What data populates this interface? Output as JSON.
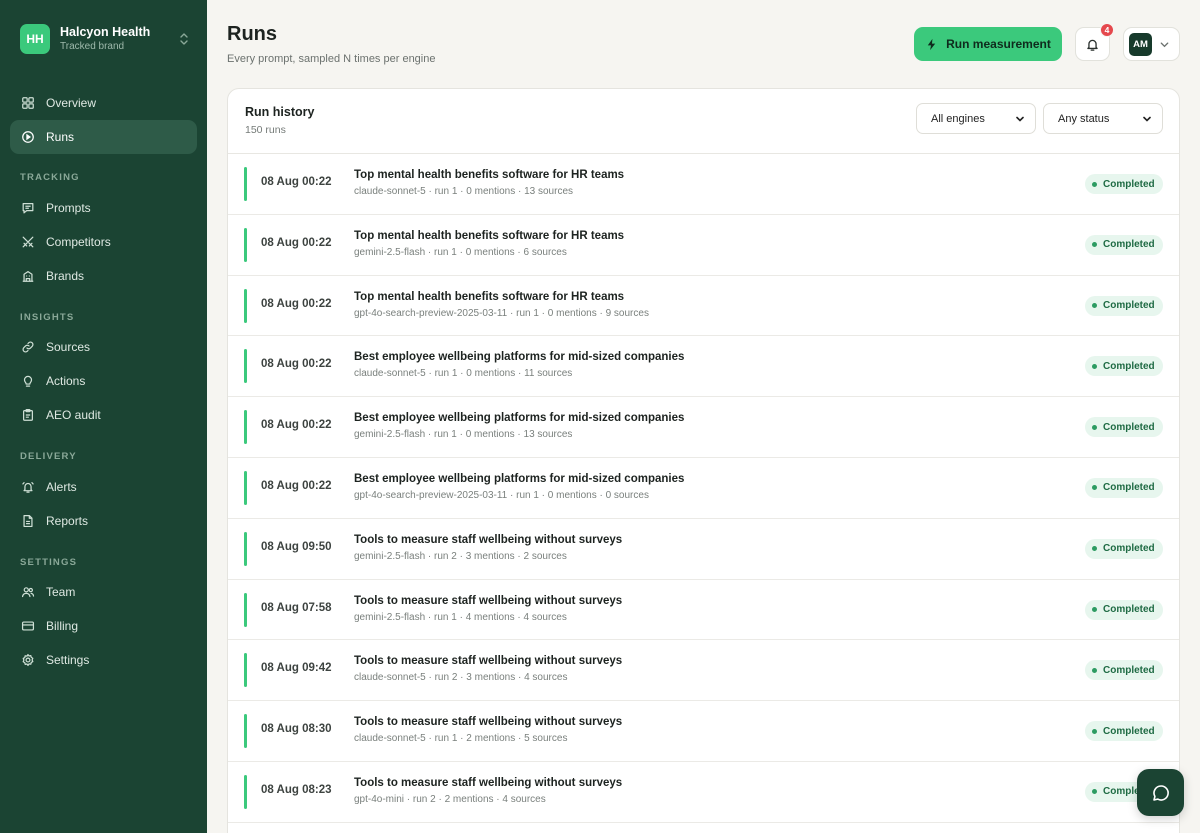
{
  "brand": {
    "initials": "HH",
    "name": "Halcyon Health",
    "subtitle": "Tracked brand"
  },
  "sidebar": {
    "overview": "Overview",
    "runs": "Runs",
    "tracking_header": "TRACKING",
    "prompts": "Prompts",
    "competitors": "Competitors",
    "brands": "Brands",
    "insights_header": "INSIGHTS",
    "sources": "Sources",
    "actions": "Actions",
    "aeo_audit": "AEO audit",
    "delivery_header": "DELIVERY",
    "alerts": "Alerts",
    "reports": "Reports",
    "settings_header": "SETTINGS",
    "team": "Team",
    "billing": "Billing",
    "settings": "Settings"
  },
  "header": {
    "title": "Runs",
    "subtitle": "Every prompt, sampled N times per engine",
    "run_button": "Run measurement",
    "notification_count": "4",
    "user_initials": "AM"
  },
  "card": {
    "title": "Run history",
    "count": "150 runs",
    "engine_filter": "All engines",
    "status_filter": "Any status"
  },
  "runs": [
    {
      "time": "08 Aug 00:22",
      "prompt": "Top mental health benefits software for HR teams",
      "meta": "claude-sonnet-5 · run 1 · 0 mentions · 13 sources",
      "status": "Completed"
    },
    {
      "time": "08 Aug 00:22",
      "prompt": "Top mental health benefits software for HR teams",
      "meta": "gemini-2.5-flash · run 1 · 0 mentions · 6 sources",
      "status": "Completed"
    },
    {
      "time": "08 Aug 00:22",
      "prompt": "Top mental health benefits software for HR teams",
      "meta": "gpt-4o-search-preview-2025-03-11 · run 1 · 0 mentions · 9 sources",
      "status": "Completed"
    },
    {
      "time": "08 Aug 00:22",
      "prompt": "Best employee wellbeing platforms for mid-sized companies",
      "meta": "claude-sonnet-5 · run 1 · 0 mentions · 11 sources",
      "status": "Completed"
    },
    {
      "time": "08 Aug 00:22",
      "prompt": "Best employee wellbeing platforms for mid-sized companies",
      "meta": "gemini-2.5-flash · run 1 · 0 mentions · 13 sources",
      "status": "Completed"
    },
    {
      "time": "08 Aug 00:22",
      "prompt": "Best employee wellbeing platforms for mid-sized companies",
      "meta": "gpt-4o-search-preview-2025-03-11 · run 1 · 0 mentions · 0 sources",
      "status": "Completed"
    },
    {
      "time": "08 Aug 09:50",
      "prompt": "Tools to measure staff wellbeing without surveys",
      "meta": "gemini-2.5-flash · run 2 · 3 mentions · 2 sources",
      "status": "Completed"
    },
    {
      "time": "08 Aug 07:58",
      "prompt": "Tools to measure staff wellbeing without surveys",
      "meta": "gemini-2.5-flash · run 1 · 4 mentions · 4 sources",
      "status": "Completed"
    },
    {
      "time": "08 Aug 09:42",
      "prompt": "Tools to measure staff wellbeing without surveys",
      "meta": "claude-sonnet-5 · run 2 · 3 mentions · 4 sources",
      "status": "Completed"
    },
    {
      "time": "08 Aug 08:30",
      "prompt": "Tools to measure staff wellbeing without surveys",
      "meta": "claude-sonnet-5 · run 1 · 2 mentions · 5 sources",
      "status": "Completed"
    },
    {
      "time": "08 Aug 08:23",
      "prompt": "Tools to measure staff wellbeing without surveys",
      "meta": "gpt-4o-mini · run 2 · 2 mentions · 4 sources",
      "status": "Completed"
    }
  ],
  "colors": {
    "sidebar_bg": "#1b4433",
    "accent": "#3bc97c",
    "badge_bg": "#e7f6ee",
    "badge_text": "#1f6b44"
  }
}
